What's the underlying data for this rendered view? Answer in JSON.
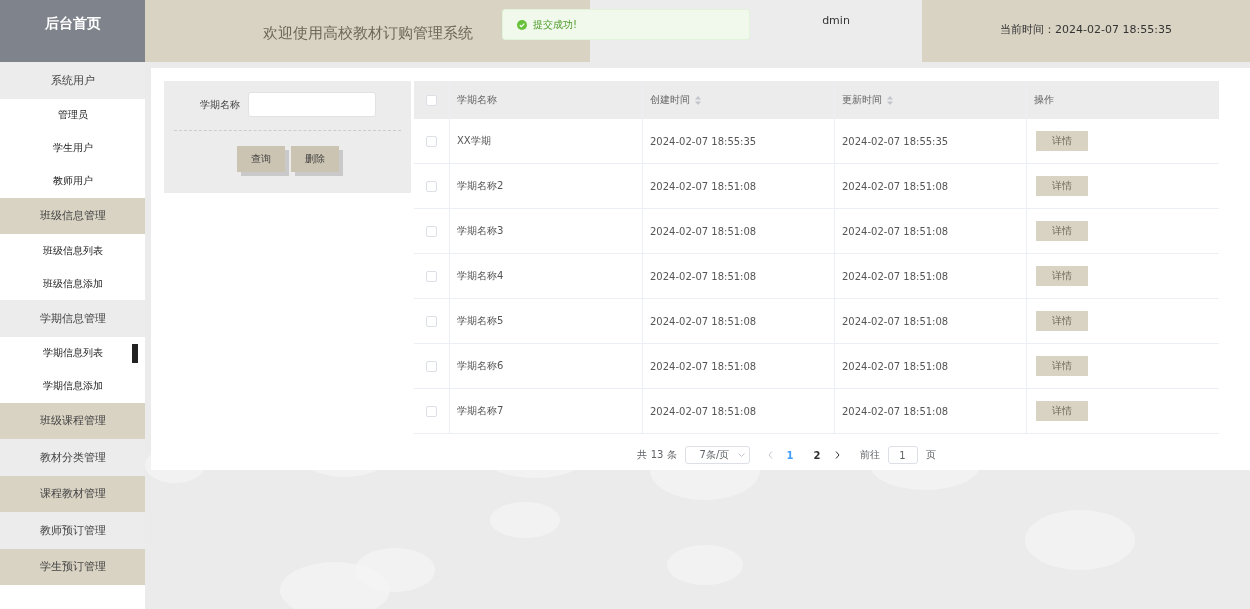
{
  "header": {
    "home": "后台首页",
    "title": "欢迎使用高校教材订购管理系统",
    "user": "dmin",
    "time": "当前时间：2024-02-07 18:55:35"
  },
  "toast": {
    "message": "提交成功!"
  },
  "sidebar": {
    "groups": [
      {
        "label": "系统用户",
        "children": [
          {
            "label": "管理员",
            "selected": false
          },
          {
            "label": "学生用户",
            "selected": false
          },
          {
            "label": "教师用户",
            "selected": false
          }
        ]
      },
      {
        "label": "班级信息管理",
        "children": [
          {
            "label": "班级信息列表",
            "selected": false
          },
          {
            "label": "班级信息添加",
            "selected": false
          }
        ]
      },
      {
        "label": "学期信息管理",
        "children": [
          {
            "label": "学期信息列表",
            "selected": true
          },
          {
            "label": "学期信息添加",
            "selected": false
          }
        ]
      },
      {
        "label": "班级课程管理"
      },
      {
        "label": "教材分类管理"
      },
      {
        "label": "课程教材管理"
      },
      {
        "label": "教师预订管理"
      },
      {
        "label": "学生预订管理"
      }
    ]
  },
  "search": {
    "label": "学期名称",
    "buttons": [
      "查询",
      "删除"
    ]
  },
  "table": {
    "select_all": {
      "checked": false
    },
    "columns": [
      {
        "label": "学期名称",
        "sortable": false
      },
      {
        "label": "创建时间",
        "sortable": true
      },
      {
        "label": "更新时间",
        "sortable": true
      },
      {
        "label": "操作",
        "sortable": false
      }
    ],
    "rows": [
      {
        "checked": false,
        "name": "XX学期",
        "created": "2024-02-07 18:55:35",
        "updated": "2024-02-07 18:55:35",
        "action": "详情"
      },
      {
        "checked": false,
        "name": "学期名称2",
        "created": "2024-02-07 18:51:08",
        "updated": "2024-02-07 18:51:08",
        "action": "详情"
      },
      {
        "checked": false,
        "name": "学期名称3",
        "created": "2024-02-07 18:51:08",
        "updated": "2024-02-07 18:51:08",
        "action": "详情"
      },
      {
        "checked": false,
        "name": "学期名称4",
        "created": "2024-02-07 18:51:08",
        "updated": "2024-02-07 18:51:08",
        "action": "详情"
      },
      {
        "checked": false,
        "name": "学期名称5",
        "created": "2024-02-07 18:51:08",
        "updated": "2024-02-07 18:51:08",
        "action": "详情"
      },
      {
        "checked": false,
        "name": "学期名称6",
        "created": "2024-02-07 18:51:08",
        "updated": "2024-02-07 18:51:08",
        "action": "详情"
      },
      {
        "checked": false,
        "name": "学期名称7",
        "created": "2024-02-07 18:51:08",
        "updated": "2024-02-07 18:51:08",
        "action": "详情"
      }
    ]
  },
  "pagination": {
    "total": "共 13 条",
    "page_size": "7条/页",
    "pages": [
      {
        "label": "1",
        "selected": true
      },
      {
        "label": "2",
        "selected": false
      }
    ],
    "goto_label": "前往",
    "goto_value": "1",
    "goto_suffix": "页"
  }
}
